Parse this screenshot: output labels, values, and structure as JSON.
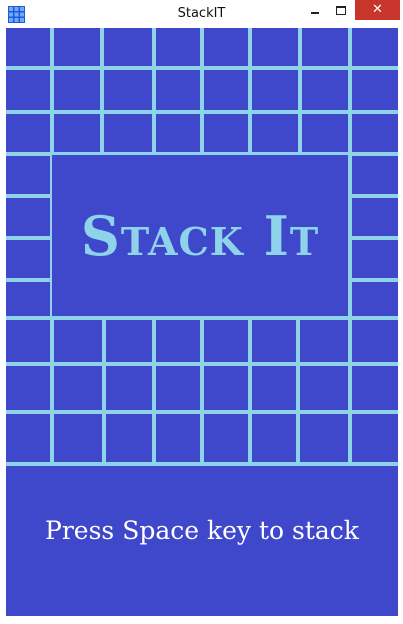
{
  "window": {
    "title": "StackIT",
    "close_glyph": "✕",
    "icon": "grid-app-icon"
  },
  "game": {
    "title": "Stack It",
    "prompt": "Press Space key to stack",
    "colors": {
      "background": "#3f47cb",
      "grid": "#8fd3ea",
      "title": "#8fd3ea",
      "prompt": "#ffffff",
      "close_button": "#c7352b"
    }
  }
}
